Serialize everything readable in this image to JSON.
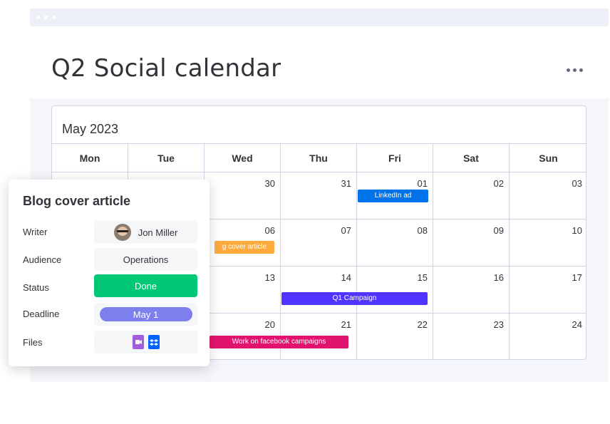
{
  "page": {
    "title": "Q2 Social calendar"
  },
  "calendar": {
    "month_label": "May 2023",
    "weekdays": [
      "Mon",
      "Tue",
      "Wed",
      "Thu",
      "Fri",
      "Sat",
      "Sun"
    ],
    "weeks": [
      {
        "days": [
          "",
          "",
          "30",
          "31",
          "01",
          "02",
          "03"
        ]
      },
      {
        "days": [
          "",
          "",
          "06",
          "07",
          "08",
          "09",
          "10"
        ]
      },
      {
        "days": [
          "",
          "",
          "13",
          "14",
          "15",
          "16",
          "17"
        ]
      },
      {
        "days": [
          "",
          "",
          "20",
          "21",
          "22",
          "23",
          "24"
        ]
      }
    ],
    "events": [
      {
        "label": "LinkedIn ad",
        "color": "#0073ea"
      },
      {
        "label": "Blog cover article",
        "visible_text": "g cover article",
        "color": "#fdab3d"
      },
      {
        "label": "Q1 Campaign",
        "color": "#5034ff"
      },
      {
        "label": "Work on facebook campaigns",
        "color": "#e2136e"
      }
    ]
  },
  "card": {
    "title": "Blog cover article",
    "fields": {
      "writer": {
        "label": "Writer",
        "value": "Jon Miller"
      },
      "audience": {
        "label": "Audience",
        "value": "Operations"
      },
      "status": {
        "label": "Status",
        "value": "Done",
        "color": "#00c875"
      },
      "deadline": {
        "label": "Deadline",
        "value": "May 1",
        "color": "#7d7fee"
      },
      "files": {
        "label": "Files",
        "icons": [
          "video-file-icon",
          "dropbox-file-icon"
        ]
      }
    }
  },
  "icons": {
    "more": "more-horizontal-icon"
  }
}
